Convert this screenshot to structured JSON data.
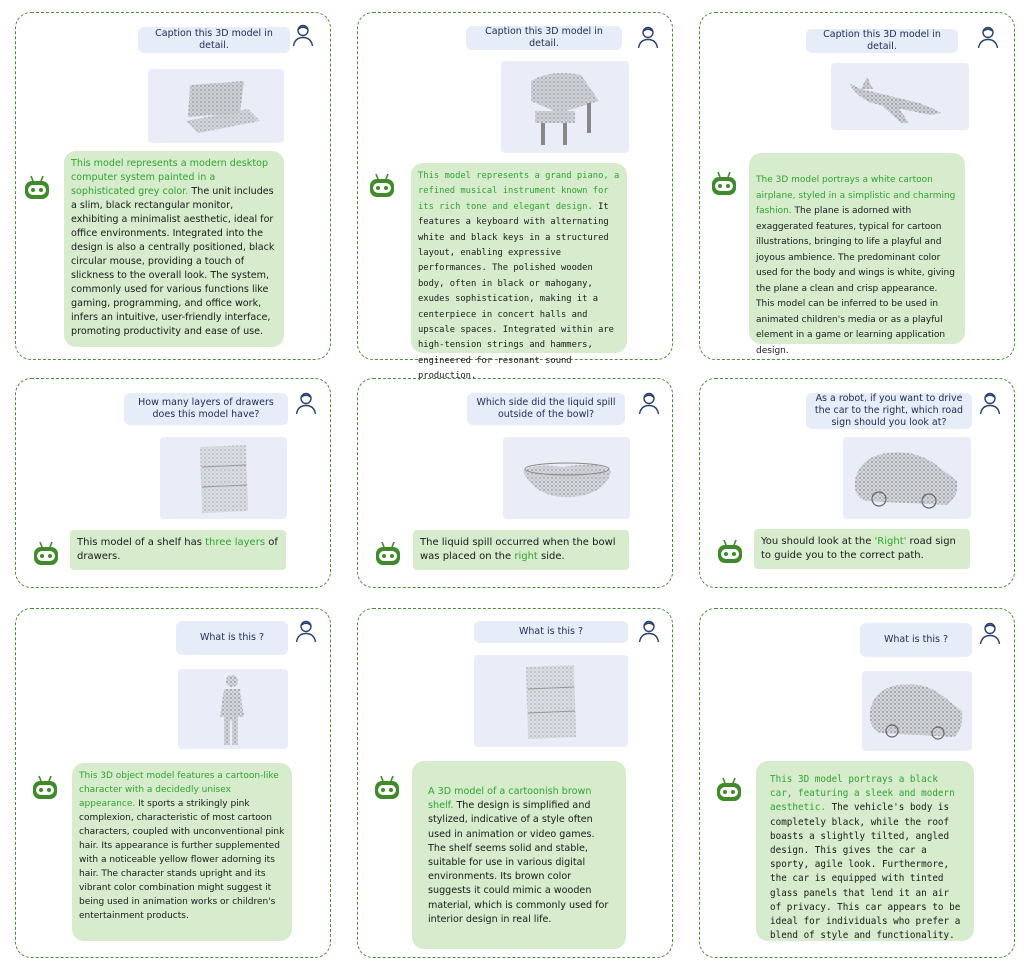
{
  "panels": [
    {
      "question": "Caption this 3D model in detail.",
      "answer_highlight": "This model represents a modern desktop computer system painted in a sophisticated grey color.",
      "answer_text": " The unit includes a slim, black rectangular monitor, exhibiting a minimalist aesthetic, ideal for office environments. Integrated into the design is also a centrally positioned, black circular mouse, providing a touch of slickness to the overall look. The system, commonly used for various functions like gaming, programming, and office work, infers an intuitive, user-friendly interface, promoting productivity and ease of use."
    },
    {
      "question": "Caption this 3D model in detail.",
      "answer_highlight": "This model represents a grand piano, a refined musical instrument known for its rich tone and elegant design.",
      "answer_text": " It features a keyboard with alternating white and black keys in a structured layout, enabling expressive performances. The polished wooden body, often in black or mahogany, exudes sophistication, making it a centerpiece in concert halls and upscale spaces. Integrated within are high-tension strings and hammers, engineered for resonant sound production."
    },
    {
      "question": "Caption this 3D model in detail.",
      "answer_highlight": "The 3D model portrays a white cartoon airplane, styled in a simplistic and charming fashion.",
      "answer_text": " The plane is adorned with exaggerated features, typical for cartoon illustrations, bringing to life a playful and joyous ambience. The predominant color used for the body and wings is white, giving the plane a clean and crisp appearance. This model can be inferred to be used in animated children's media or as a playful element in a game or learning application design."
    },
    {
      "question": "How many layers of drawers does this model have?",
      "answer_pre": "This model of a shelf has ",
      "answer_highlight": "three layers",
      "answer_post": " of drawers."
    },
    {
      "question": "Which side did the liquid spill outside of the bowl?",
      "answer_pre": "The liquid spill occurred when the bowl was placed on the ",
      "answer_highlight": "right",
      "answer_post": " side."
    },
    {
      "question": "As a robot, if you want to drive the car to the right, which road sign should you look at?",
      "answer_pre": "You should look at the ",
      "answer_highlight": "'Right'",
      "answer_post": " road sign to guide you to the correct path."
    },
    {
      "question": "What is this ?",
      "answer_highlight": "This 3D object model features a cartoon-like character with a decidedly unisex appearance.",
      "answer_text": " It sports a strikingly pink complexion, characteristic of most cartoon characters, coupled with unconventional pink hair. Its appearance is further supplemented with a noticeable yellow flower adorning its hair. The character stands upright and its vibrant color combination might suggest it being used in animation works or children's entertainment products."
    },
    {
      "question": "What is this ?",
      "answer_highlight": "A 3D model of a cartoonish brown shelf.",
      "answer_text": " The design is simplified and stylized, indicative of a style often used in animation or video games. The shelf seems solid and stable, suitable for use in various digital environments. Its brown color suggests it could mimic a wooden material, which is commonly used for interior design in real life."
    },
    {
      "question": "What is this ?",
      "answer_highlight": "This 3D model portrays a black car, featuring a sleek and modern aesthetic.",
      "answer_text": " The vehicle's body is completely black, while the roof boasts a slightly tilted, angled design. This gives the car a sporty, agile look. Furthermore, the car is equipped with tinted glass panels that lend it an air of privacy. This car appears to be ideal for individuals who prefer a blend of style and functionality."
    }
  ],
  "colors": {
    "border": "#4f8a3c",
    "highlight": "#2fa52f",
    "answer_bg": "#d7ebcd",
    "question_bg": "#e6ecf8",
    "robot": "#3f8a2a",
    "user_icon": "#27406e"
  },
  "icons": {
    "user": "user-icon",
    "robot": "robot-icon"
  }
}
